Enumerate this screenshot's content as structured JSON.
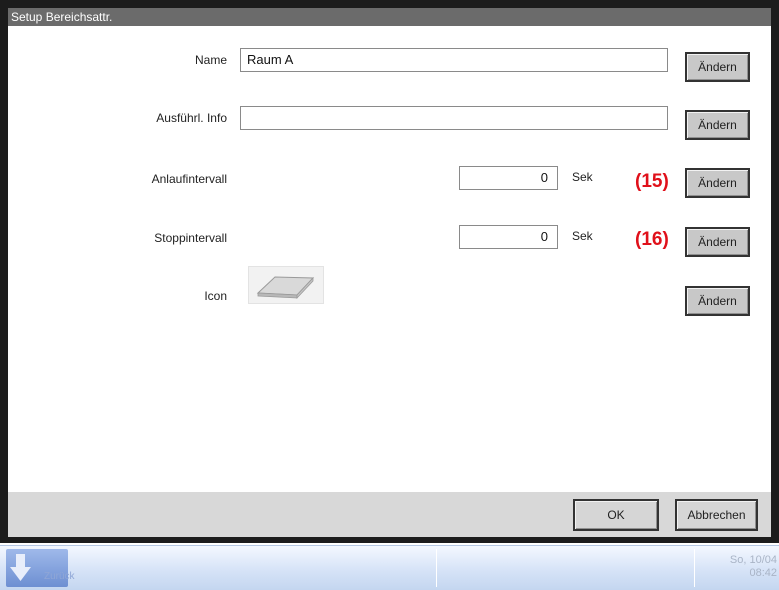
{
  "window": {
    "title": "Setup Bereichsattr."
  },
  "rows": {
    "name": {
      "label": "Name",
      "value": "Raum A",
      "button": "Ändern"
    },
    "info": {
      "label": "Ausführl. Info",
      "value": "",
      "button": "Ändern"
    },
    "start": {
      "label": "Anlaufintervall",
      "value": "0",
      "unit": "Sek",
      "marker": "(15)",
      "button": "Ändern"
    },
    "stop": {
      "label": "Stoppintervall",
      "value": "0",
      "unit": "Sek",
      "marker": "(16)",
      "button": "Ändern"
    },
    "icon": {
      "label": "Icon",
      "icon_name": "area-tile-icon",
      "button": "Ändern"
    }
  },
  "footer": {
    "ok": "OK",
    "cancel": "Abbrechen"
  },
  "taskbar": {
    "back_label": "Zurück",
    "date": "So, 10/04",
    "time": "08:42"
  },
  "colors": {
    "marker": "#e0101a",
    "title_bar": "#6b6b6b",
    "taskbar": "#d6e3f7"
  }
}
